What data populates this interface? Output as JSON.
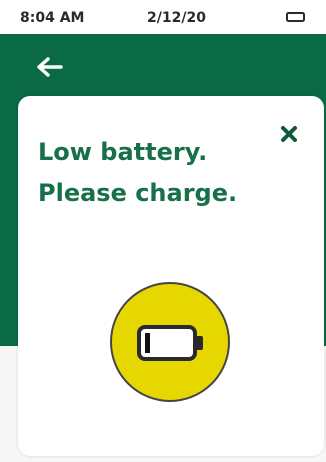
{
  "status_bar": {
    "time": "8:04 AM",
    "date": "2/12/20",
    "battery_icon": "battery-icon"
  },
  "header": {
    "back_icon": "arrow-left-icon"
  },
  "dialog": {
    "line1": "Low battery.",
    "line2": "Please charge.",
    "close_icon": "close-icon",
    "battery_low_icon": "battery-low-icon",
    "battery_level": 0.12
  },
  "colors": {
    "brand_green": "#0a6a45",
    "text_green": "#17704a",
    "warning_yellow": "#e7d700"
  }
}
